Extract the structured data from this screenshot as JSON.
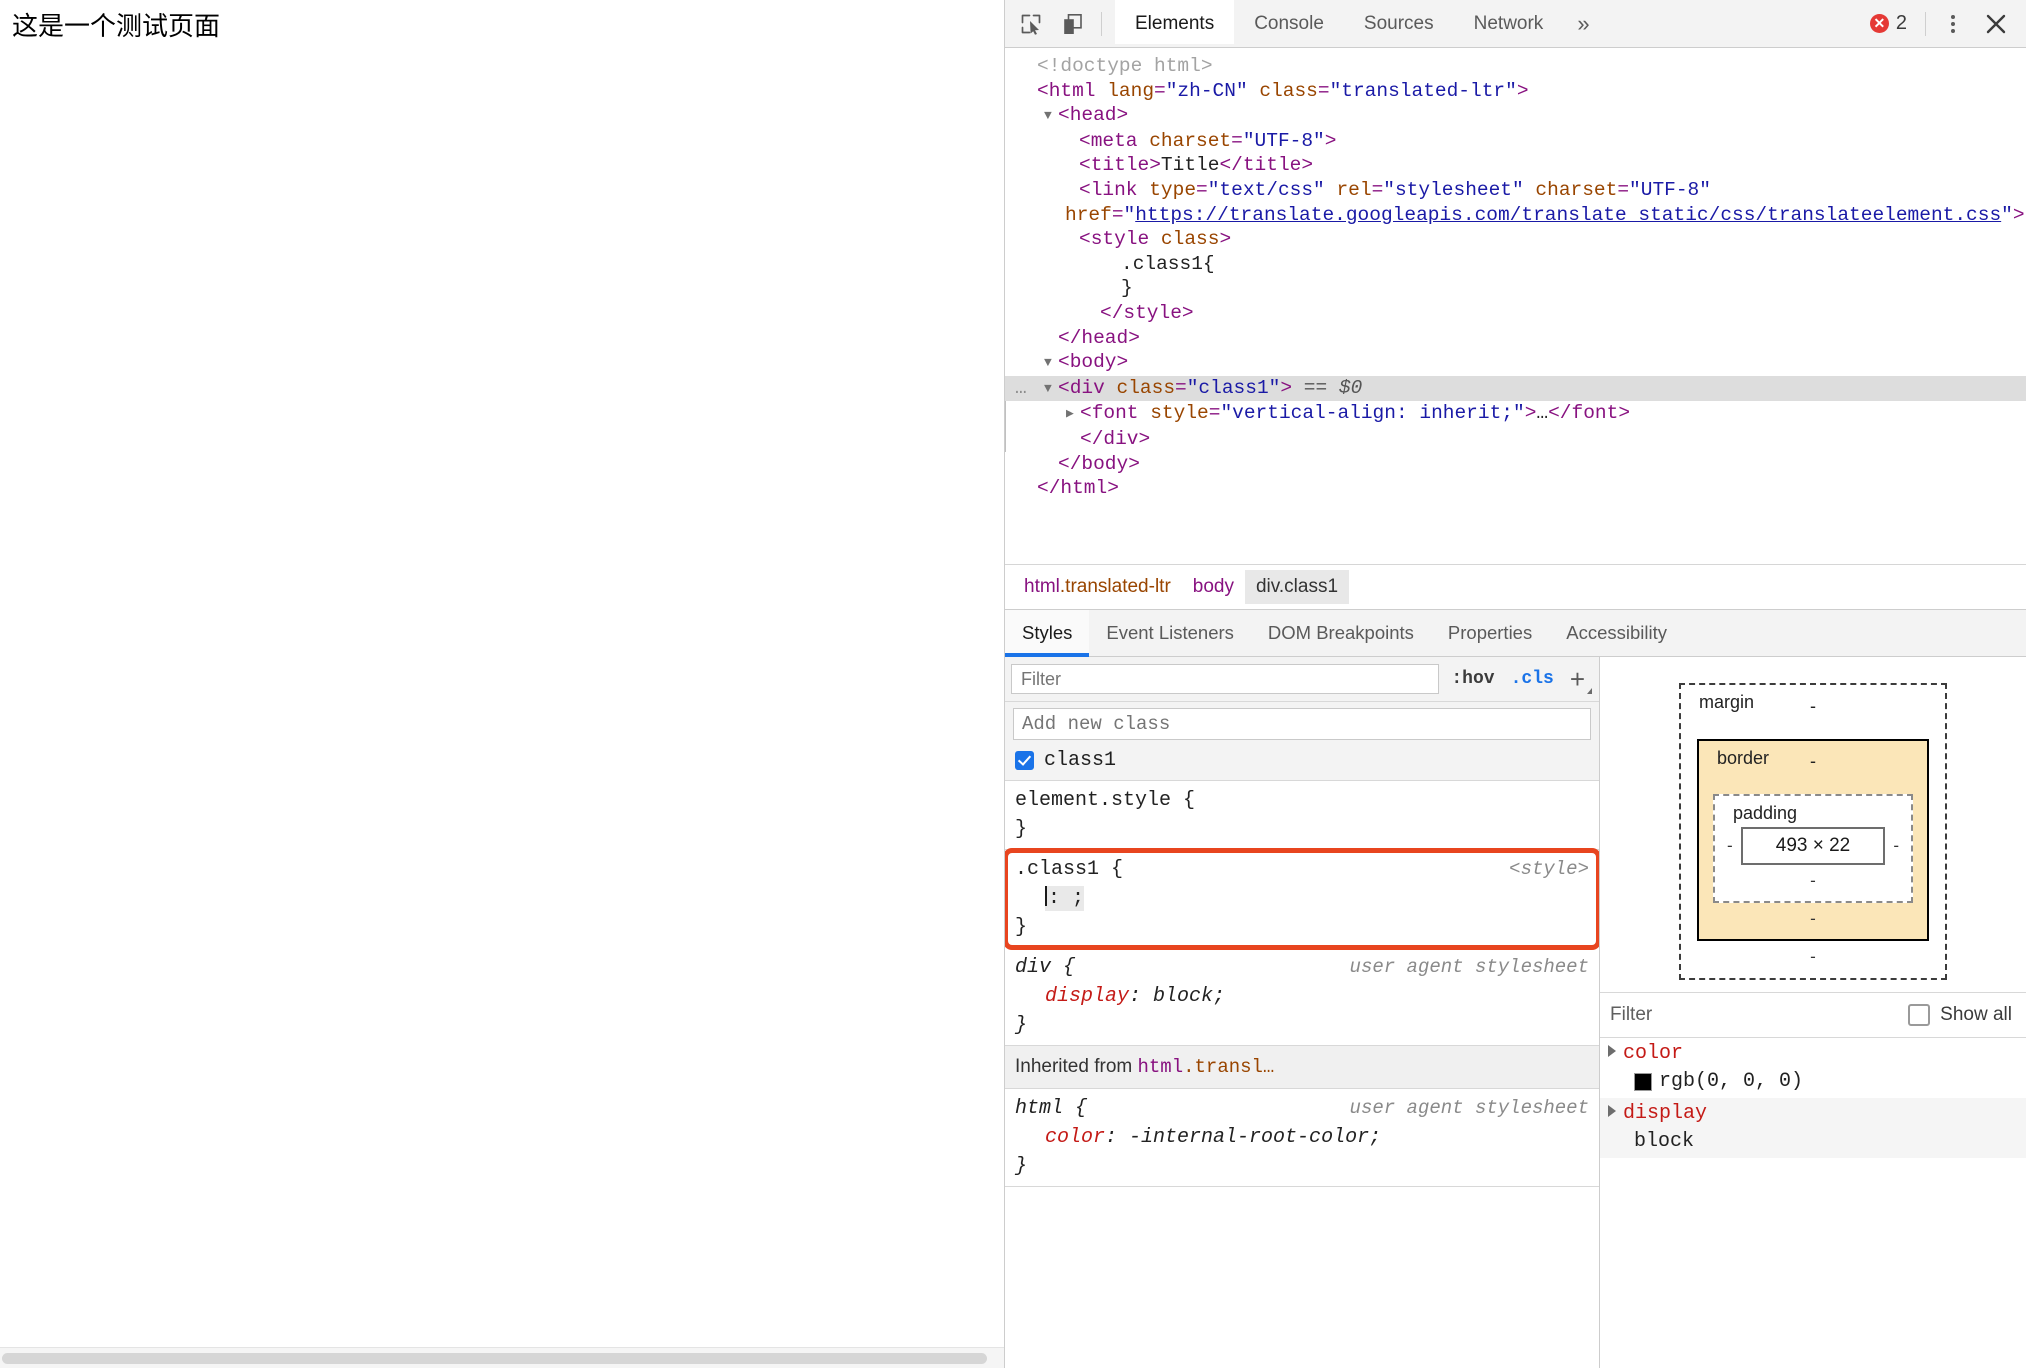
{
  "page": {
    "heading": "这是一个测试页面"
  },
  "devtools": {
    "toolbar": {
      "inspect_icon": "inspect-element-icon",
      "device_icon": "device-toolbar-icon",
      "tabs": [
        {
          "label": "Elements",
          "active": true
        },
        {
          "label": "Console",
          "active": false
        },
        {
          "label": "Sources",
          "active": false
        },
        {
          "label": "Network",
          "active": false
        }
      ],
      "more_tabs_label": "»",
      "error_count": "2",
      "kebab_label": "customize-and-control-icon",
      "close_label": "✕"
    },
    "dom_tree": [
      {
        "indent": 0,
        "twisty": "",
        "parts": [
          {
            "t": "comment",
            "v": "<!doctype html>"
          }
        ]
      },
      {
        "indent": 0,
        "twisty": "",
        "parts": [
          {
            "t": "punct",
            "v": "<"
          },
          {
            "t": "tag",
            "v": "html"
          },
          {
            "t": "sp",
            "v": " "
          },
          {
            "t": "attr",
            "v": "lang"
          },
          {
            "t": "punct",
            "v": "="
          },
          {
            "t": "val",
            "v": "\"zh-CN\""
          },
          {
            "t": "sp",
            "v": " "
          },
          {
            "t": "attr",
            "v": "class"
          },
          {
            "t": "punct",
            "v": "="
          },
          {
            "t": "val",
            "v": "\"translated-ltr\""
          },
          {
            "t": "punct",
            "v": ">"
          }
        ]
      },
      {
        "indent": 1,
        "twisty": "down",
        "parts": [
          {
            "t": "punct",
            "v": "<"
          },
          {
            "t": "tag",
            "v": "head"
          },
          {
            "t": "punct",
            "v": ">"
          }
        ]
      },
      {
        "indent": 2,
        "twisty": "",
        "parts": [
          {
            "t": "punct",
            "v": "<"
          },
          {
            "t": "tag",
            "v": "meta"
          },
          {
            "t": "sp",
            "v": " "
          },
          {
            "t": "attr",
            "v": "charset"
          },
          {
            "t": "punct",
            "v": "="
          },
          {
            "t": "val",
            "v": "\"UTF-8\""
          },
          {
            "t": "punct",
            "v": ">"
          }
        ]
      },
      {
        "indent": 2,
        "twisty": "",
        "parts": [
          {
            "t": "punct",
            "v": "<"
          },
          {
            "t": "tag",
            "v": "title"
          },
          {
            "t": "punct",
            "v": ">"
          },
          {
            "t": "txt",
            "v": "Title"
          },
          {
            "t": "punct",
            "v": "</"
          },
          {
            "t": "tag",
            "v": "title"
          },
          {
            "t": "punct",
            "v": ">"
          }
        ]
      },
      {
        "indent": 2,
        "twisty": "",
        "parts": [
          {
            "t": "punct",
            "v": "<"
          },
          {
            "t": "tag",
            "v": "link"
          },
          {
            "t": "sp",
            "v": " "
          },
          {
            "t": "attr",
            "v": "type"
          },
          {
            "t": "punct",
            "v": "="
          },
          {
            "t": "val",
            "v": "\"text/css\""
          },
          {
            "t": "sp",
            "v": " "
          },
          {
            "t": "attr",
            "v": "rel"
          },
          {
            "t": "punct",
            "v": "="
          },
          {
            "t": "val",
            "v": "\"stylesheet\""
          },
          {
            "t": "sp",
            "v": " "
          },
          {
            "t": "attr",
            "v": "charset"
          },
          {
            "t": "punct",
            "v": "="
          },
          {
            "t": "val",
            "v": "\"UTF-8\""
          },
          {
            "t": "sp",
            "v": " "
          },
          {
            "t": "attr",
            "v": "href"
          },
          {
            "t": "punct",
            "v": "="
          },
          {
            "t": "val",
            "v": "\""
          },
          {
            "t": "link",
            "v": "https://translate.googleapis.com/translate_static/css/translateelement.css"
          },
          {
            "t": "val",
            "v": "\""
          },
          {
            "t": "punct",
            "v": ">"
          }
        ]
      },
      {
        "indent": 2,
        "twisty": "",
        "parts": [
          {
            "t": "punct",
            "v": "<"
          },
          {
            "t": "tag",
            "v": "style"
          },
          {
            "t": "sp",
            "v": " "
          },
          {
            "t": "attr",
            "v": "class"
          },
          {
            "t": "punct",
            "v": ">"
          }
        ]
      },
      {
        "indent": 4,
        "twisty": "",
        "parts": [
          {
            "t": "txt",
            "v": ".class1{"
          }
        ]
      },
      {
        "indent": 4,
        "twisty": "",
        "parts": [
          {
            "t": "txt",
            "v": "}"
          }
        ]
      },
      {
        "indent": 3,
        "twisty": "",
        "parts": [
          {
            "t": "punct",
            "v": "</"
          },
          {
            "t": "tag",
            "v": "style"
          },
          {
            "t": "punct",
            "v": ">"
          }
        ]
      },
      {
        "indent": 1,
        "twisty": "",
        "parts": [
          {
            "t": "punct",
            "v": "</"
          },
          {
            "t": "tag",
            "v": "head"
          },
          {
            "t": "punct",
            "v": ">"
          }
        ]
      },
      {
        "indent": 1,
        "twisty": "down",
        "parts": [
          {
            "t": "punct",
            "v": "<"
          },
          {
            "t": "tag",
            "v": "body"
          },
          {
            "t": "punct",
            "v": ">"
          }
        ]
      },
      {
        "indent": 1,
        "twisty": "down",
        "selected": true,
        "gutter": "…",
        "parts": [
          {
            "t": "punct",
            "v": "<"
          },
          {
            "t": "tag",
            "v": "div"
          },
          {
            "t": "sp",
            "v": " "
          },
          {
            "t": "attr",
            "v": "class"
          },
          {
            "t": "punct",
            "v": "="
          },
          {
            "t": "val",
            "v": "\"class1\""
          },
          {
            "t": "punct",
            "v": ">"
          },
          {
            "t": "sp",
            "v": " "
          },
          {
            "t": "dollar",
            "v": "== $0"
          }
        ]
      },
      {
        "indent": 2,
        "twisty": "right",
        "guide": true,
        "parts": [
          {
            "t": "punct",
            "v": "<"
          },
          {
            "t": "tag",
            "v": "font"
          },
          {
            "t": "sp",
            "v": " "
          },
          {
            "t": "attr",
            "v": "style"
          },
          {
            "t": "punct",
            "v": "="
          },
          {
            "t": "val",
            "v": "\"vertical-align: inherit;\""
          },
          {
            "t": "punct",
            "v": ">"
          },
          {
            "t": "txt",
            "v": "…"
          },
          {
            "t": "punct",
            "v": "</"
          },
          {
            "t": "tag",
            "v": "font"
          },
          {
            "t": "punct",
            "v": ">"
          }
        ]
      },
      {
        "indent": 2,
        "twisty": "",
        "guide": true,
        "parts": [
          {
            "t": "punct",
            "v": "</"
          },
          {
            "t": "tag",
            "v": "div"
          },
          {
            "t": "punct",
            "v": ">"
          }
        ]
      },
      {
        "indent": 1,
        "twisty": "",
        "parts": [
          {
            "t": "punct",
            "v": "</"
          },
          {
            "t": "tag",
            "v": "body"
          },
          {
            "t": "punct",
            "v": ">"
          }
        ]
      },
      {
        "indent": 0,
        "twisty": "",
        "parts": [
          {
            "t": "punct",
            "v": "</"
          },
          {
            "t": "tag",
            "v": "html"
          },
          {
            "t": "punct",
            "v": ">"
          }
        ]
      }
    ],
    "breadcrumb": [
      {
        "tag": "html",
        "cls": ".translated-ltr",
        "active": false
      },
      {
        "tag": "body",
        "cls": "",
        "active": false
      },
      {
        "tag": "div",
        "cls": ".class1",
        "active": true
      }
    ],
    "styles_tabs": [
      {
        "label": "Styles",
        "active": true
      },
      {
        "label": "Event Listeners",
        "active": false
      },
      {
        "label": "DOM Breakpoints",
        "active": false
      },
      {
        "label": "Properties",
        "active": false
      },
      {
        "label": "Accessibility",
        "active": false
      }
    ],
    "styles_filter": {
      "placeholder": "Filter",
      "value": "",
      "hov_label": ":hov",
      "cls_label": ".cls",
      "plus_label": "+"
    },
    "class_editor": {
      "add_class_placeholder": "Add new class",
      "classes": [
        {
          "name": "class1",
          "checked": true
        }
      ]
    },
    "css_rules": [
      {
        "selector": "element.style {",
        "origin": "",
        "close": "}",
        "declarations": [],
        "highlighted": false,
        "ua": false
      },
      {
        "selector": ".class1 {",
        "origin": "<style>",
        "close": "}",
        "declarations": [
          {
            "prop": "",
            "value": "",
            "editing": true,
            "raw": ": ;"
          }
        ],
        "highlighted": true,
        "ua": false
      },
      {
        "selector": "div {",
        "origin": "user agent stylesheet",
        "close": "}",
        "declarations": [
          {
            "prop": "display",
            "value": "block",
            "editing": false,
            "raw": ""
          }
        ],
        "highlighted": false,
        "ua": true
      }
    ],
    "inherited_header": {
      "prefix": "Inherited from ",
      "tag": "html",
      "cls": ".transl…"
    },
    "inherited_rules": [
      {
        "selector": "html {",
        "origin": "user agent stylesheet",
        "close": "}",
        "declarations": [
          {
            "prop": "color",
            "value": "-internal-root-color",
            "editing": false,
            "raw": ""
          }
        ],
        "highlighted": false,
        "ua": true
      }
    ],
    "box_model": {
      "margin_label": "margin",
      "margin_value": "-",
      "border_label": "border",
      "border_value": "-",
      "padding_label": "padding",
      "padding_value": "-",
      "content_size": "493 × 22",
      "side_dash": "-"
    },
    "computed": {
      "filter_placeholder": "Filter",
      "show_all_label": "Show all",
      "show_all_checked": false,
      "properties": [
        {
          "name": "color",
          "value": "rgb(0, 0, 0)",
          "swatch": "#000000"
        },
        {
          "name": "display",
          "value": "block",
          "swatch": ""
        }
      ]
    }
  },
  "colors": {
    "accent_blue": "#1a73e8",
    "highlight_orange": "#e8451f",
    "error_red": "#e53935",
    "box_border_yellow": "#fbe6b8"
  }
}
